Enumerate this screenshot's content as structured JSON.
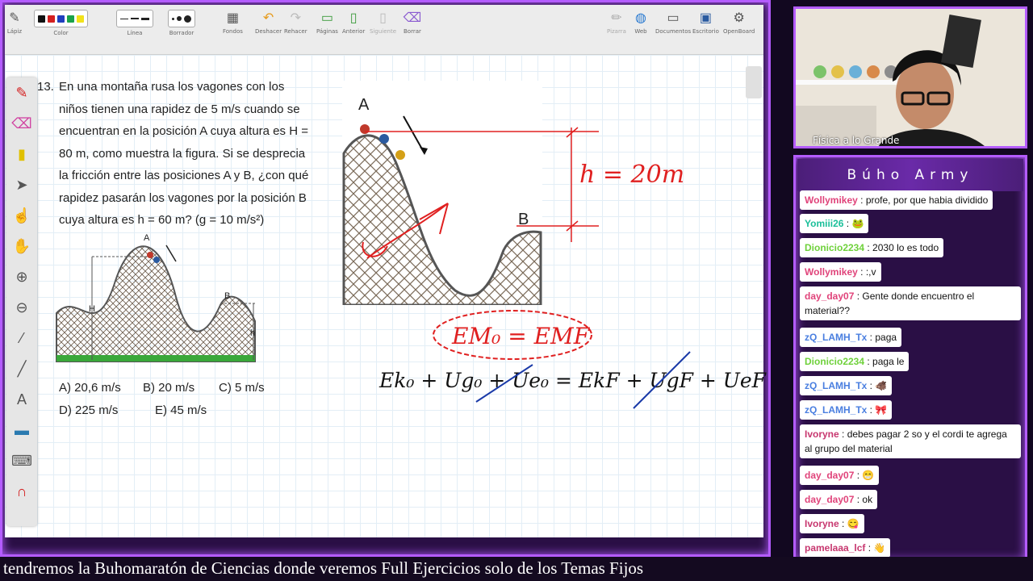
{
  "toolbar": {
    "items": [
      {
        "label": "Lápiz",
        "icon": "pen-icon"
      },
      {
        "label": "Color",
        "icon": "color-swatches"
      },
      {
        "label": "Línea",
        "icon": "line-style"
      },
      {
        "label": "Borrador",
        "icon": "eraser-size"
      },
      {
        "label": "Fondos",
        "icon": "background-icon"
      },
      {
        "label": "Deshacer",
        "icon": "undo-icon"
      },
      {
        "label": "Rehacer",
        "icon": "redo-icon"
      },
      {
        "label": "Páginas",
        "icon": "add-page-icon"
      },
      {
        "label": "Anterior",
        "icon": "previous-page-icon"
      },
      {
        "label": "Siguiente",
        "icon": "next-page-icon"
      },
      {
        "label": "Borrar",
        "icon": "clear-icon"
      },
      {
        "label": "Pizarra",
        "icon": "board-icon"
      },
      {
        "label": "Web",
        "icon": "globe-icon"
      },
      {
        "label": "Documentos",
        "icon": "folder-icon"
      },
      {
        "label": "Escritorio",
        "icon": "desktop-icon"
      },
      {
        "label": "OpenBoard",
        "icon": "gear-icon"
      }
    ],
    "colors": [
      "#111111",
      "#d42020",
      "#1f3fbf",
      "#1aa24a",
      "#f2e21a"
    ]
  },
  "problem": {
    "number": "13.",
    "lines": [
      "En una montaña rusa los vagones con los",
      "niños tienen una rapidez de 5 m/s cuando se",
      "encuentran en la posición A cuya altura es H =",
      "80 m, como muestra la figura. Si se desprecia",
      "la fricción entre las posiciones A y B, ¿con qué",
      "rapidez pasarán los vagones por la posición B",
      "cuya altura es h = 60 m? (g = 10 m/s²)"
    ],
    "options": [
      "A) 20,6 m/s",
      "B) 20 m/s",
      "C) 5 m/s",
      "D) 225 m/s",
      "E) 45 m/s"
    ],
    "figure_labels": {
      "a": "A",
      "b": "B",
      "H": "H",
      "h": "h"
    }
  },
  "handwriting": {
    "h_label": "h = 20m",
    "big_a": "A",
    "big_b": "B",
    "energy_eq": "EM₀ = EMF",
    "expanded_eq": "Ek₀ + Ug₀ + Ue₀ = EkF + UgF + UeF"
  },
  "cam": {
    "label": "Física a lo Grande"
  },
  "chat": {
    "title": "Búho Army",
    "messages": [
      {
        "user": "Wollymikey",
        "text": "profe, por que habia dividido",
        "color": "#e0437a"
      },
      {
        "user": "Yomiii26",
        "text": "🐸",
        "color": "#1bbf9a"
      },
      {
        "user": "Dionicio2234",
        "text": "2030 lo es todo",
        "color": "#6fd13b"
      },
      {
        "user": "Wollymikey",
        "text": ":,v",
        "color": "#e0437a"
      },
      {
        "user": "day_day07",
        "text": "Gente donde encuentro el material??",
        "color": "#e0437a"
      },
      {
        "user": "zQ_LAMH_Tx",
        "text": "paga",
        "color": "#4a7fe0"
      },
      {
        "user": "Dionicio2234",
        "text": "paga le",
        "color": "#6fd13b"
      },
      {
        "user": "zQ_LAMH_Tx",
        "text": "🐗",
        "color": "#4a7fe0"
      },
      {
        "user": "zQ_LAMH_Tx",
        "text": "🎀",
        "color": "#4a7fe0"
      },
      {
        "user": "Ivoryne",
        "text": "debes pagar 2 so y el cordi te agrega al grupo del material",
        "color": "#c7376f"
      },
      {
        "user": "day_day07",
        "text": "😁",
        "color": "#e0437a"
      },
      {
        "user": "day_day07",
        "text": "ok",
        "color": "#e0437a"
      },
      {
        "user": "Ivoryne",
        "text": "😋",
        "color": "#c7376f"
      },
      {
        "user": "pamelaaa_lcf",
        "text": "👋",
        "color": "#c7376f"
      }
    ]
  },
  "ticker": {
    "text": "tendremos la Buhomaratón de Ciencias donde veremos Full Ejercicios solo de los Temas Fijos"
  }
}
